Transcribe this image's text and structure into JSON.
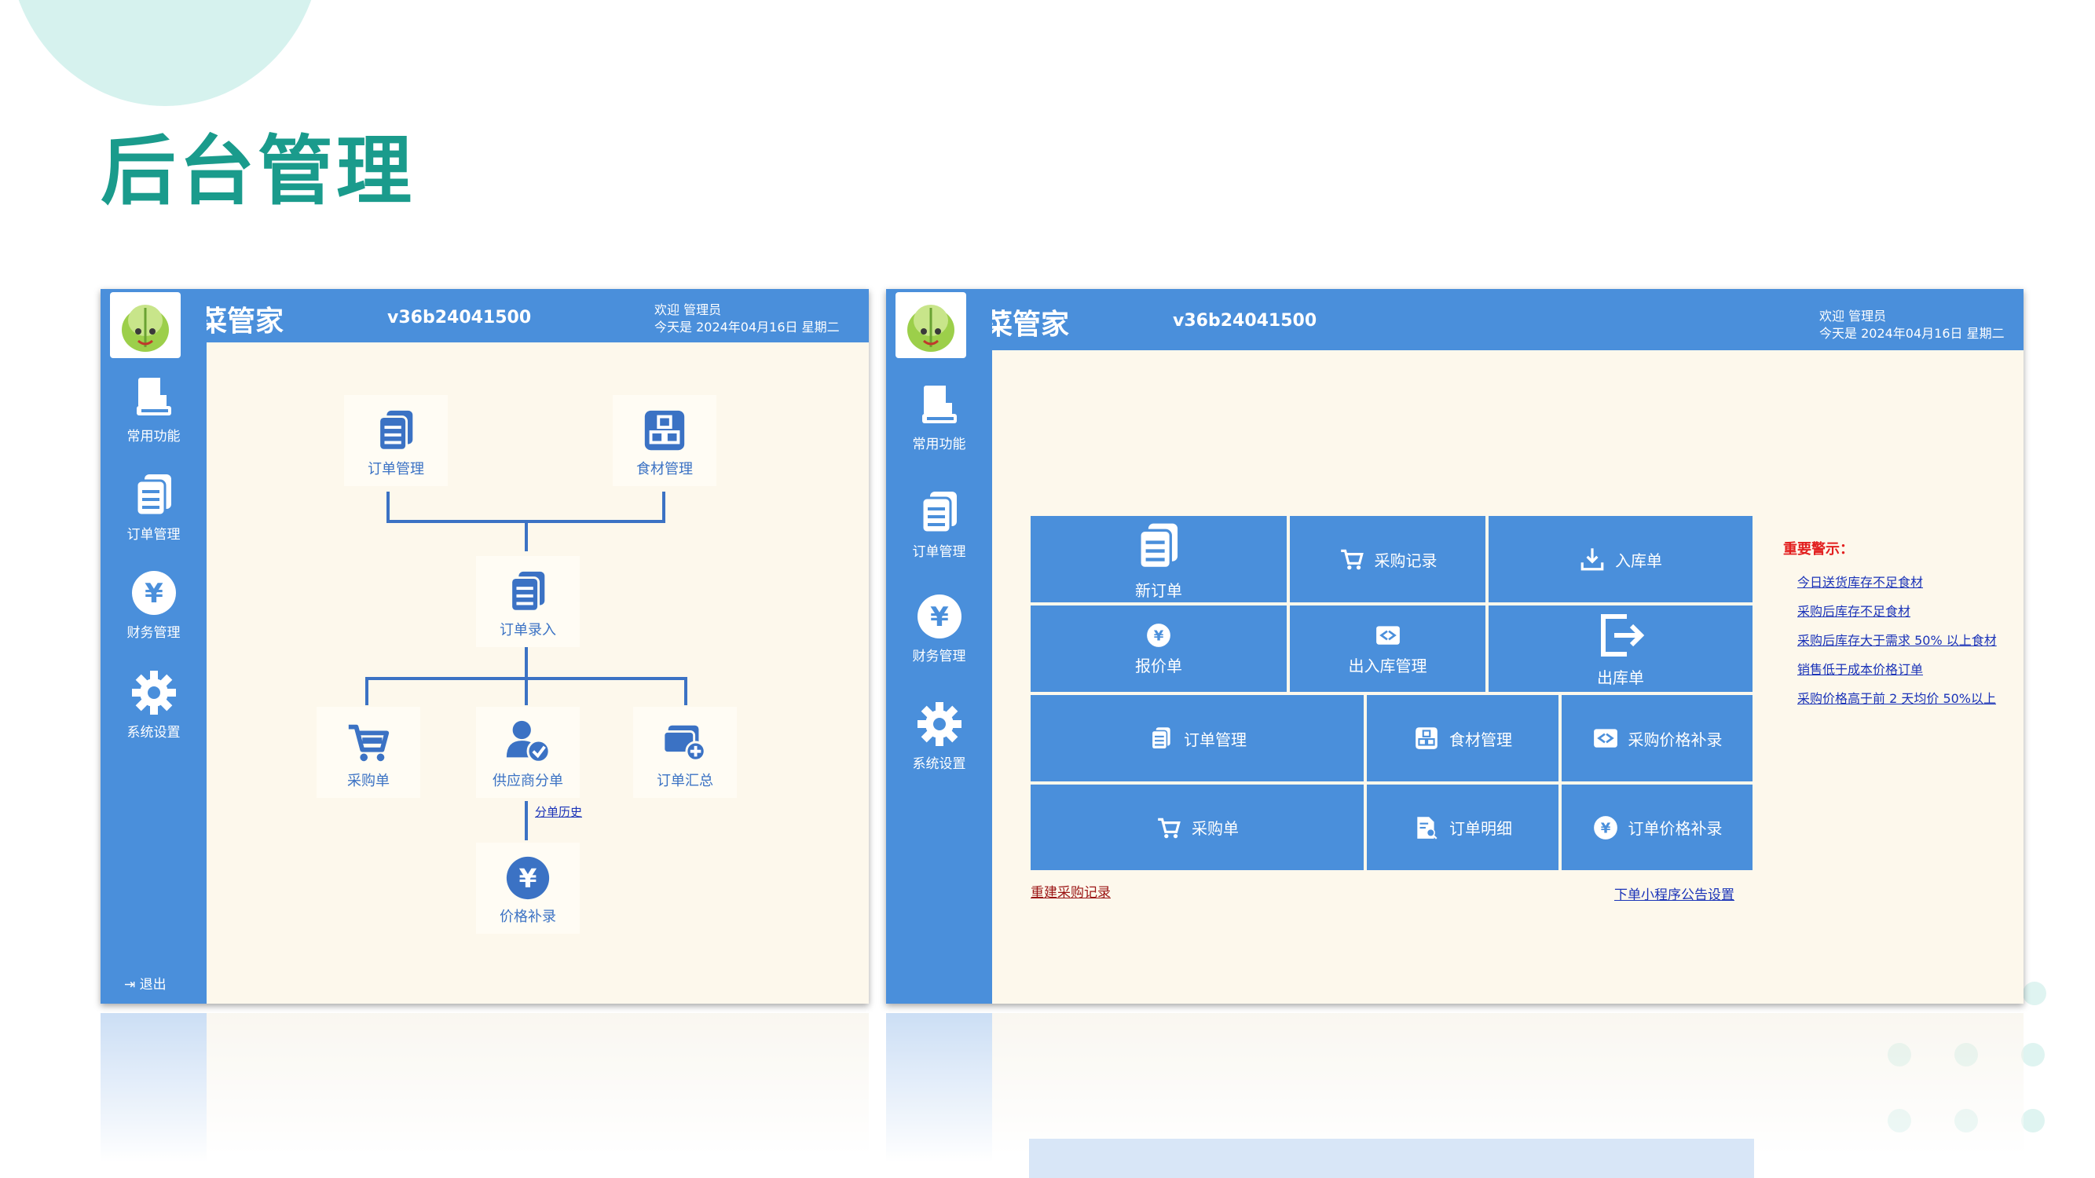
{
  "page": {
    "title": "后台管理"
  },
  "app": {
    "brand": "菜管家",
    "version": "v36b24041500",
    "welcome_line1": "欢迎 管理员",
    "welcome_line2": "今天是 2024年04月16日 星期二"
  },
  "sidebar": {
    "items": [
      {
        "label": "常用功能",
        "icon": "book-icon"
      },
      {
        "label": "订单管理",
        "icon": "order-document-icon"
      },
      {
        "label": "财务管理",
        "icon": "yen-coin-icon"
      },
      {
        "label": "系统设置",
        "icon": "gear-icon"
      }
    ],
    "logout": "退出"
  },
  "flow": {
    "order_mgmt": "订单管理",
    "food_mgmt": "食材管理",
    "order_entry": "订单录入",
    "purchase_order": "采购单",
    "supplier_split": "供应商分单",
    "order_summary": "订单汇总",
    "split_history": "分单历史",
    "price_supplement": "价格补录"
  },
  "grid": {
    "new_order": "新订单",
    "purchase_records": "采购记录",
    "stock_in": "入库单",
    "quote": "报价单",
    "inout_mgmt": "出入库管理",
    "stock_out": "出库单",
    "order_mgmt": "订单管理",
    "food_mgmt": "食材管理",
    "purchase_price_supplement": "采购价格补录",
    "purchase_order": "采购单",
    "order_detail": "订单明细",
    "order_price_supplement": "订单价格补录"
  },
  "links": {
    "rebuild_purchase": "重建采购记录",
    "notice_settings": "下单小程序公告设置"
  },
  "alerts": {
    "title": "重要警示：",
    "items": [
      "今日送货库存不足食材",
      "采购后库存不足食材",
      "采购后库存大于需求 50% 以上食材",
      "销售低于成本价格订单",
      "采购价格高于前 2 天均价 50%以上"
    ]
  },
  "colors": {
    "accent": "#4a8fdb",
    "title": "#1a9b8c",
    "panel_bg": "#fdf8ec",
    "alert": "#e21f1f",
    "link": "#1a33b8"
  }
}
